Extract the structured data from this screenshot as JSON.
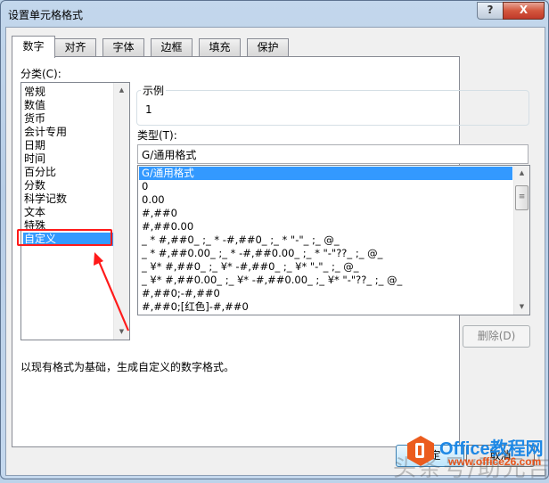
{
  "window": {
    "title": "设置单元格格式",
    "help_glyph": "?",
    "close_glyph": "X"
  },
  "tabs": [
    {
      "label": "数字",
      "active": true
    },
    {
      "label": "对齐",
      "active": false
    },
    {
      "label": "字体",
      "active": false
    },
    {
      "label": "边框",
      "active": false
    },
    {
      "label": "填充",
      "active": false
    },
    {
      "label": "保护",
      "active": false
    }
  ],
  "category": {
    "label": "分类(C):",
    "items": [
      "常规",
      "数值",
      "货币",
      "会计专用",
      "日期",
      "时间",
      "百分比",
      "分数",
      "科学记数",
      "文本",
      "特殊",
      "自定义"
    ],
    "selected": "自定义",
    "scroll_up_glyph": "▲",
    "scroll_down_glyph": "▼"
  },
  "sample": {
    "legend": "示例",
    "value": "1"
  },
  "type": {
    "label": "类型(T):",
    "input_value": "G/通用格式",
    "items": [
      "G/通用格式",
      "0",
      "0.00",
      "#,##0",
      "#,##0.00",
      "_ * #,##0_ ;_ * -#,##0_ ;_ * \"-\"_ ;_ @_",
      "_ * #,##0.00_ ;_ * -#,##0.00_ ;_ * \"-\"??_ ;_ @_",
      "_ ¥* #,##0_ ;_ ¥* -#,##0_ ;_ ¥* \"-\"_ ;_ @_",
      "_ ¥* #,##0.00_ ;_ ¥* -#,##0.00_ ;_ ¥* \"-\"??_ ;_ @_",
      "#,##0;-#,##0",
      "#,##0;[红色]-#,##0"
    ],
    "selected": "G/通用格式",
    "thumb_glyph": "≡"
  },
  "buttons": {
    "delete": "删除(D)",
    "ok": "确定",
    "cancel": "取消"
  },
  "description": "以现有格式为基础，生成自定义的数字格式。",
  "annotation": {
    "color": "#ff1a1a"
  },
  "watermark": {
    "title": "Office教程网",
    "url": "www.office26.com",
    "faint_text": "头条号/助元吉"
  },
  "colors": {
    "selection": "#3399ff",
    "close_button": "#c7402b",
    "watermark_blue": "#1e88e5",
    "watermark_orange": "#eb5c1e"
  }
}
